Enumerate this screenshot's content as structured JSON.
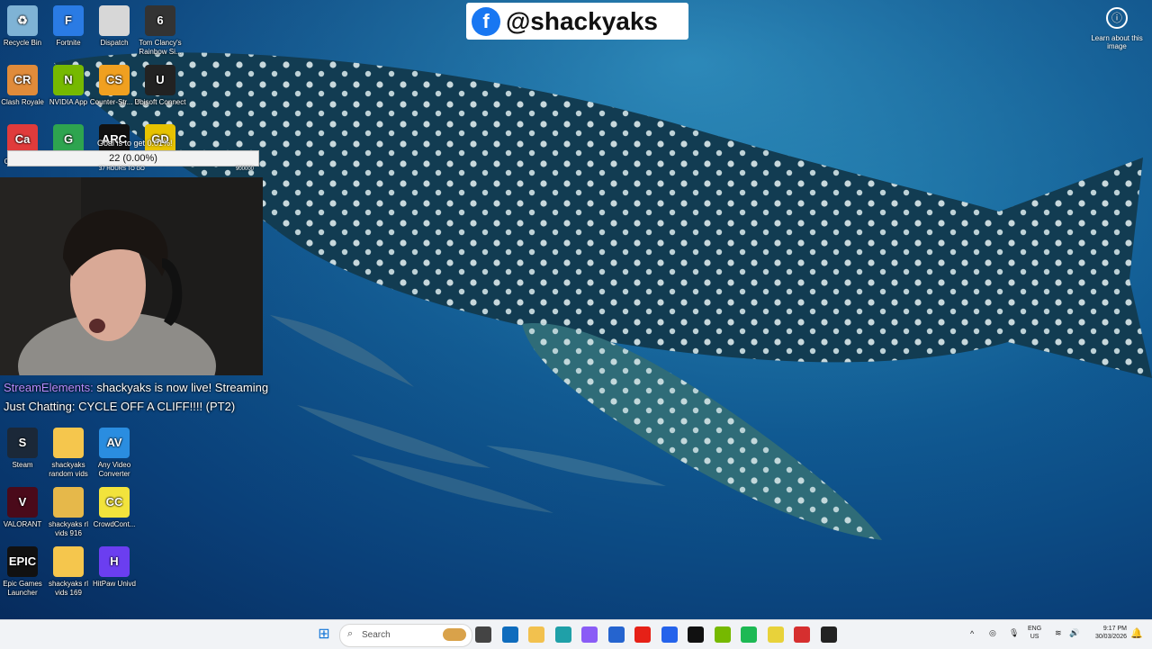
{
  "banner": {
    "handle": "@shackyaks",
    "logo_letter": "f"
  },
  "learn": {
    "label": "Learn about this image",
    "icon": "info-icon"
  },
  "icons": [
    {
      "label": "Recycle Bin",
      "abbr": "♻",
      "color": "#7fb3d5"
    },
    {
      "label": "Fortnite",
      "abbr": "F",
      "color": "#2a7be4"
    },
    {
      "label": "Dispatch",
      "abbr": "",
      "color": "#d7d7d7"
    },
    {
      "label": "Tom Clancy's Rainbow Si...",
      "abbr": "6",
      "color": "#333"
    },
    {
      "label": "Clash Royale",
      "abbr": "CR",
      "color": "#e08b3a"
    },
    {
      "label": "NVIDIA App",
      "abbr": "N",
      "color": "#76b900"
    },
    {
      "label": "Counter-Str... 2",
      "abbr": "CS",
      "color": "#f0a020"
    },
    {
      "label": "Ubisoft Connect",
      "abbr": "U",
      "color": "#222"
    },
    {
      "label": "Caffeinated",
      "abbr": "Ca",
      "color": "#e03b3b"
    },
    {
      "label": "Games",
      "abbr": "G",
      "color": "#2ea44f"
    },
    {
      "label": "ARC Raiders",
      "abbr": "ARC",
      "color": "#111"
    },
    {
      "label": "Geometry Dash",
      "abbr": "GD",
      "color": "#e6c200"
    },
    {
      "label": "Steam",
      "abbr": "S",
      "color": "#1b2838"
    },
    {
      "label": "shackyaks random vids",
      "abbr": "",
      "color": "#f5c64d"
    },
    {
      "label": "Any Video Converter",
      "abbr": "AV",
      "color": "#2a8de0"
    },
    {
      "label": "VALORANT",
      "abbr": "V",
      "color": "#4a0a1a"
    },
    {
      "label": "shackyaks rl vids 916",
      "abbr": "",
      "color": "#e6b84a"
    },
    {
      "label": "CrowdCont...",
      "abbr": "CC",
      "color": "#f2e33c"
    },
    {
      "label": "Epic Games Launcher",
      "abbr": "EPIC",
      "color": "#111"
    },
    {
      "label": "shackyaks rl vids 169",
      "abbr": "",
      "color": "#f5c64d"
    },
    {
      "label": "HitPaw Univd",
      "abbr": "H",
      "color": "#6b3ef0"
    }
  ],
  "goal": {
    "top": "Goal is to get 0.01%!",
    "bar": "22 (0.00%)",
    "left": "37 HOURS TO GO",
    "right": "900000"
  },
  "alert": {
    "source": "StreamElements:",
    "line1": " shackyaks is now live! Streaming",
    "line2": "Just Chatting: CYCLE OFF A CLIFF!!!! (PT2)"
  },
  "taskbar": {
    "search_placeholder": "Search",
    "apps": [
      "task-view",
      "outlook",
      "file-explorer",
      "edge",
      "copilot",
      "store",
      "youtube",
      "gift",
      "capcut",
      "nvidia",
      "spotify",
      "crowdcontrol",
      "caffeinated",
      "obs"
    ],
    "tray": {
      "lang1": "ENG",
      "lang2": "US",
      "time": "9:17 PM",
      "date": "30/03/2026"
    }
  }
}
